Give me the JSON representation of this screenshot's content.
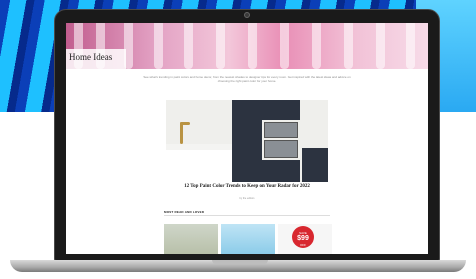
{
  "site": {
    "section_title": "Home Ideas",
    "intro_text": "See what's trending in paint colors and home decor, from the newest shades to designer tips for every room. Get inspired with the latest ideas and advice on choosing the right paint color for your home.",
    "feature": {
      "headline": "12 Top Paint Color Trends to Keep on Your Radar for 2022",
      "byline": "by the editors"
    },
    "most_read_label": "MOST READ AND LOVED",
    "thumbs": [
      {
        "alt": "living room"
      },
      {
        "alt": "blue product"
      },
      {
        "alt": "sale item",
        "badge_line1": "SAVE",
        "badge_price": "$99",
        "badge_line2": "OFF"
      }
    ]
  },
  "colors": {
    "accent_pink": "#e98fb6",
    "badge_red": "#d8272f",
    "bg_blue": "#1ec0ff"
  }
}
